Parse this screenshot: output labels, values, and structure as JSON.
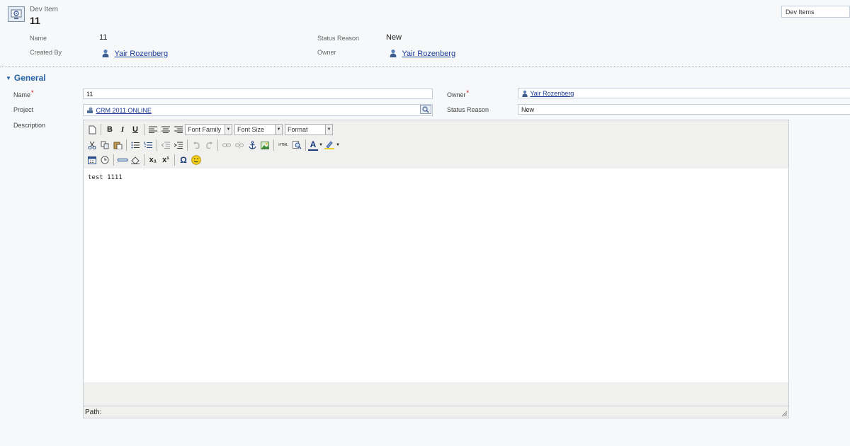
{
  "header": {
    "entity_type": "Dev Item",
    "record_title": "11",
    "fields": {
      "name_label": "Name",
      "name_value": "11",
      "created_by_label": "Created By",
      "created_by_value": "Yair Rozenberg",
      "status_reason_label": "Status Reason",
      "status_reason_value": "New",
      "owner_label": "Owner",
      "owner_value": "Yair Rozenberg"
    },
    "view_selector": "Dev Items"
  },
  "section": {
    "title": "General"
  },
  "form": {
    "name_label": "Name",
    "name_required": "*",
    "name_value": "11",
    "project_label": "Project",
    "project_value": "CRM 2011 ONLINE",
    "description_label": "Description",
    "owner_label": "Owner",
    "owner_required": "*",
    "owner_value": "Yair Rozenberg",
    "status_reason_label": "Status Reason",
    "status_reason_value": "New"
  },
  "editor": {
    "font_family": "Font Family",
    "font_size": "Font Size",
    "format": "Format",
    "content": "test 1111",
    "path_label": "Path:",
    "toolbar_icons": [
      "new-document-icon",
      "bold-icon",
      "italic-icon",
      "underline-icon",
      "align-left-icon",
      "align-center-icon",
      "align-right-icon",
      "cut-icon",
      "copy-icon",
      "paste-icon",
      "bullet-list-icon",
      "numbered-list-icon",
      "outdent-icon",
      "indent-icon",
      "undo-icon",
      "redo-icon",
      "link-icon",
      "unlink-icon",
      "anchor-icon",
      "image-icon",
      "html-icon",
      "search-replace-icon",
      "font-color-icon",
      "highlight-color-icon",
      "insert-date-icon",
      "insert-time-icon",
      "horizontal-rule-icon",
      "remove-format-icon",
      "subscript-icon",
      "superscript-icon",
      "special-char-icon",
      "emoticon-icon"
    ],
    "glyphs": {
      "bold": "B",
      "italic": "I",
      "underline": "U",
      "html": "HTML",
      "omega": "Ω",
      "smiley": "☺",
      "subscript": "x₁",
      "superscript": "x¹",
      "font_color": "A"
    }
  },
  "colors": {
    "link": "#1a3d96",
    "section_title": "#2462a8",
    "required": "#cc0000"
  }
}
